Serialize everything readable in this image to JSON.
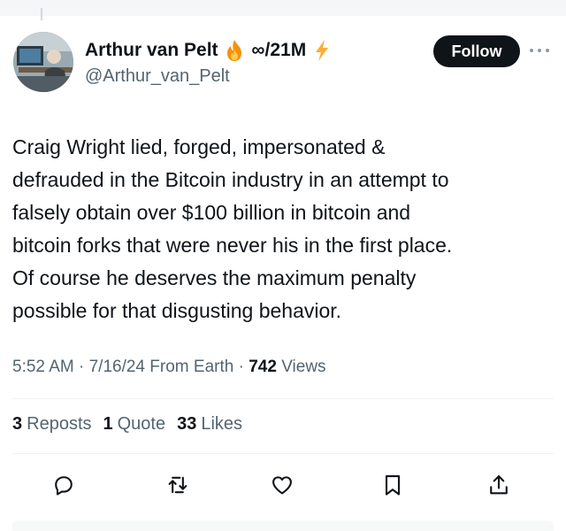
{
  "author": {
    "display_name": "Arthur van Pelt",
    "name_suffix": "∞/21M",
    "handle": "@Arthur_van_Pelt",
    "badges": [
      "fire-emoji",
      "lightning-emoji"
    ]
  },
  "follow_label": "Follow",
  "tweet": {
    "lines": [
      "Craig Wright lied, forged, impersonated &",
      "defrauded in the Bitcoin industry in an attempt to",
      "falsely obtain over $100 billion in bitcoin and",
      "bitcoin forks that were never his in the first place.",
      "Of course he deserves the maximum penalty",
      "possible for that disgusting behavior."
    ]
  },
  "meta": {
    "time": "5:52 AM",
    "separator": "·",
    "date": "7/16/24",
    "source": "From Earth",
    "views_count": "742",
    "views_label": "Views"
  },
  "stats": {
    "reposts_count": "3",
    "reposts_label": "Reposts",
    "quotes_count": "1",
    "quotes_label": "Quote",
    "likes_count": "33",
    "likes_label": "Likes"
  },
  "actions": [
    "reply-icon",
    "repost-icon",
    "like-icon",
    "bookmark-icon",
    "share-icon"
  ],
  "colors": {
    "text": "#0f1419",
    "secondary": "#536471",
    "divider": "#eff3f4",
    "follow_bg": "#0f1419",
    "follow_text": "#ffffff"
  }
}
